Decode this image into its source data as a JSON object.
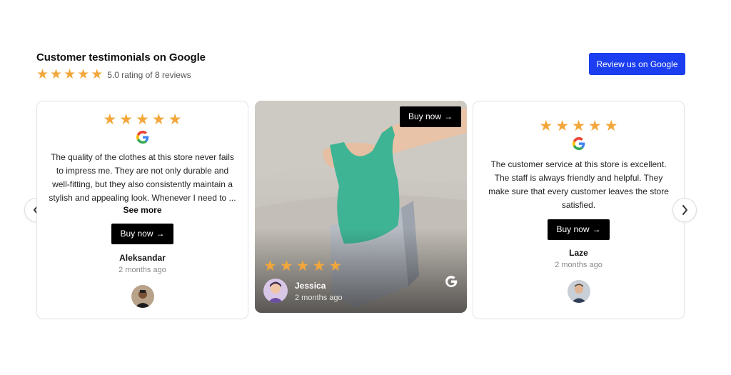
{
  "header": {
    "title": "Customer testimonials on Google",
    "rating_text": "5.0 rating of 8 reviews",
    "rating_value": 5,
    "star_count": 5
  },
  "review_button": {
    "label": "Review us on Google"
  },
  "colors": {
    "accent": "#1a3ef0",
    "star": "#f3a73b",
    "button": "#000000"
  },
  "reviews": [
    {
      "stars": 5,
      "source_icon": "google-icon",
      "quote_lines": [
        "The quality of the clothes at this store never fails",
        "to impress me. They are not only durable and",
        "well-fitting, but they also consistently maintain a",
        "stylish and appealing look. Whenever I need to ..."
      ],
      "see_more": "See more",
      "buy_label": "Buy now",
      "author": "Aleksandar",
      "time": "2 months ago"
    },
    {
      "stars": 5,
      "source_icon": "google-icon",
      "buy_label": "Buy now",
      "author": "Jessica",
      "time": "2 months ago"
    },
    {
      "stars": 5,
      "source_icon": "google-icon",
      "quote_lines": [
        "The customer service at this store is excellent.",
        "The staff is always friendly and helpful. They",
        "make sure that every customer leaves the store",
        "satisfied."
      ],
      "buy_label": "Buy now",
      "author": "Laze",
      "time": "2 months ago"
    }
  ],
  "icons": {
    "arrow": "→",
    "prev": "chevron-left-icon",
    "next": "chevron-right-icon"
  }
}
